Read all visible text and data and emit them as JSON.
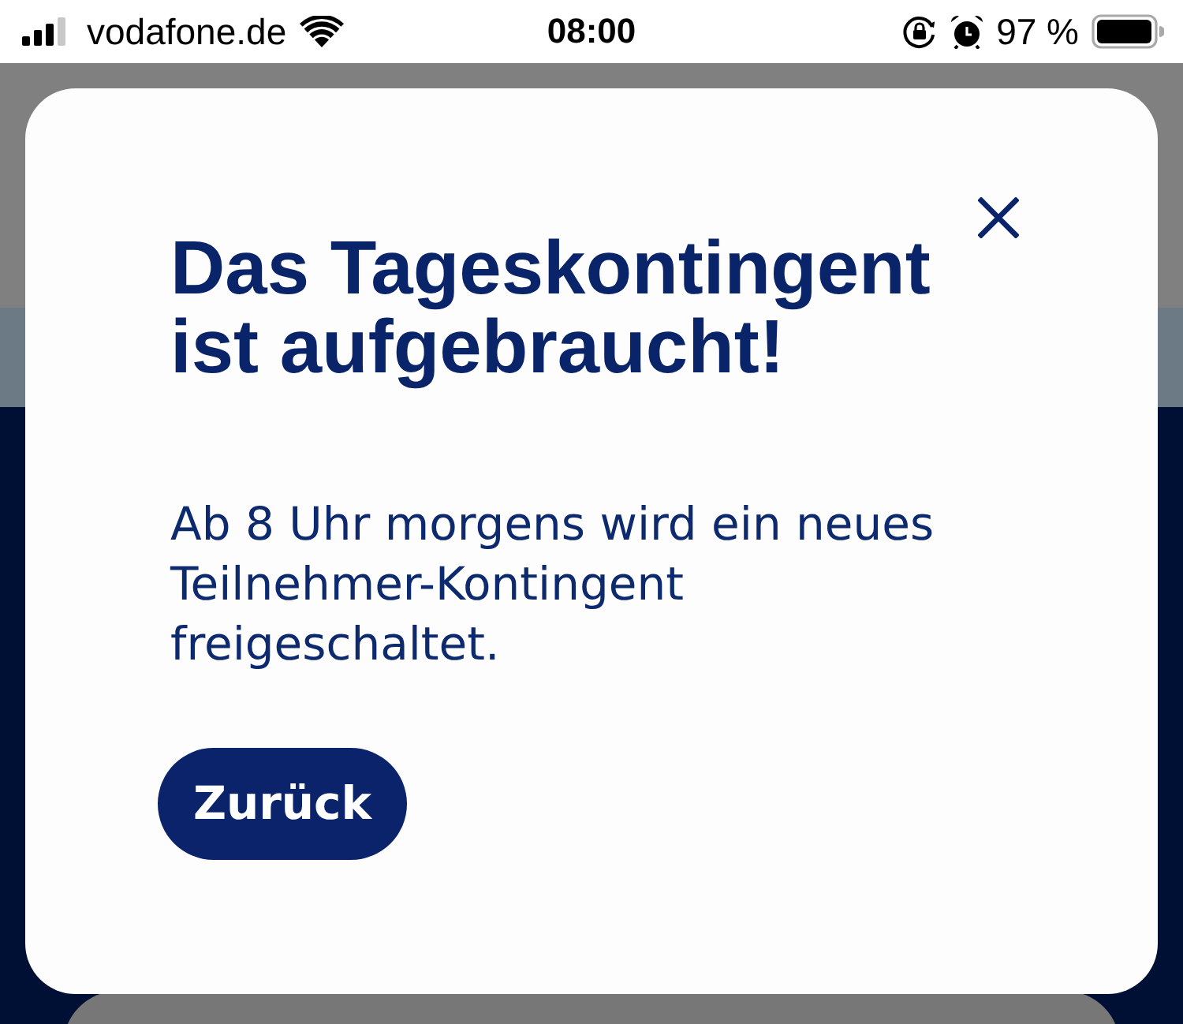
{
  "status_bar": {
    "carrier": "vodafone.de",
    "time": "08:00",
    "battery": "97 %"
  },
  "dialog": {
    "title": "Das Tageskontingent ist aufgebraucht!",
    "message": "Ab 8 Uhr morgens wird ein neues Teilnehmer-Kontingent freigeschaltet.",
    "button": "Zurück"
  }
}
